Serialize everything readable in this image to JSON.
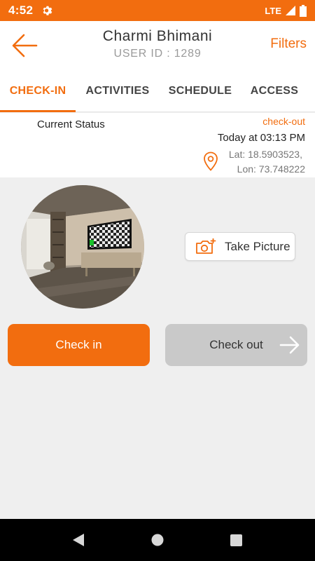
{
  "status_bar": {
    "time": "4:52",
    "network": "LTE"
  },
  "header": {
    "title": "Charmi Bhimani",
    "subtitle": "USER ID : 1289",
    "filters_label": "Filters"
  },
  "tabs": [
    {
      "label": "CHECK-IN",
      "active": true
    },
    {
      "label": "ACTIVITIES",
      "active": false
    },
    {
      "label": "SCHEDULE",
      "active": false
    },
    {
      "label": "ACCESS",
      "active": false
    }
  ],
  "status": {
    "label": "Current Status",
    "checkout_link": "check-out",
    "time_text": "Today at 03:13 PM",
    "lat_text": "Lat: 18.5903523,",
    "lon_text": "Lon: 73.748222"
  },
  "take_picture_label": "Take Picture",
  "buttons": {
    "check_in": "Check in",
    "check_out": "Check out"
  },
  "colors": {
    "accent": "#f26d0f",
    "disabled": "#c9c9c9"
  }
}
